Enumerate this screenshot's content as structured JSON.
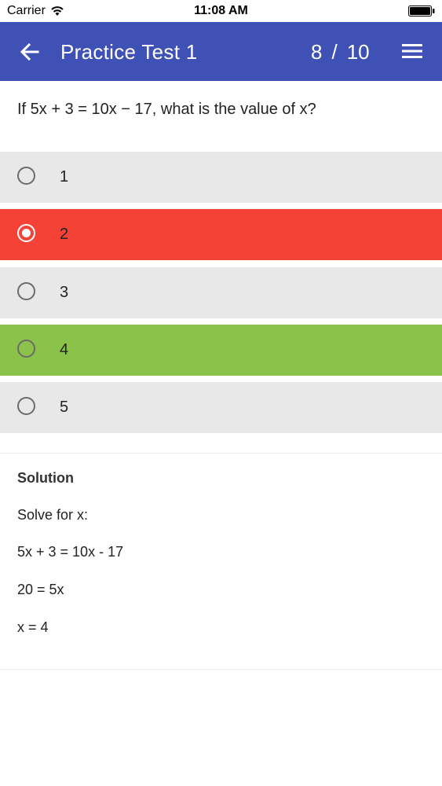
{
  "status_bar": {
    "carrier": "Carrier",
    "time": "11:08 AM"
  },
  "app_bar": {
    "title": "Practice Test 1",
    "current_question": "8",
    "separator": "/",
    "total_questions": "10",
    "back_icon": "arrow-left-icon",
    "menu_icon": "hamburger-menu-icon",
    "color": "#3f51b5"
  },
  "question": "If 5x + 3 = 10x − 17, what is the value of x?",
  "options": [
    {
      "label": "1",
      "state": "neutral",
      "color": "#e8e8e8"
    },
    {
      "label": "2",
      "state": "selected-incorrect",
      "color": "#f44336"
    },
    {
      "label": "3",
      "state": "neutral",
      "color": "#e8e8e8"
    },
    {
      "label": "4",
      "state": "correct",
      "color": "#8bc34a"
    },
    {
      "label": "5",
      "state": "neutral",
      "color": "#e8e8e8"
    }
  ],
  "solution": {
    "title": "Solution",
    "lines": [
      "Solve for x:",
      "5x + 3 = 10x - 17",
      "20 = 5x",
      "x = 4"
    ]
  }
}
